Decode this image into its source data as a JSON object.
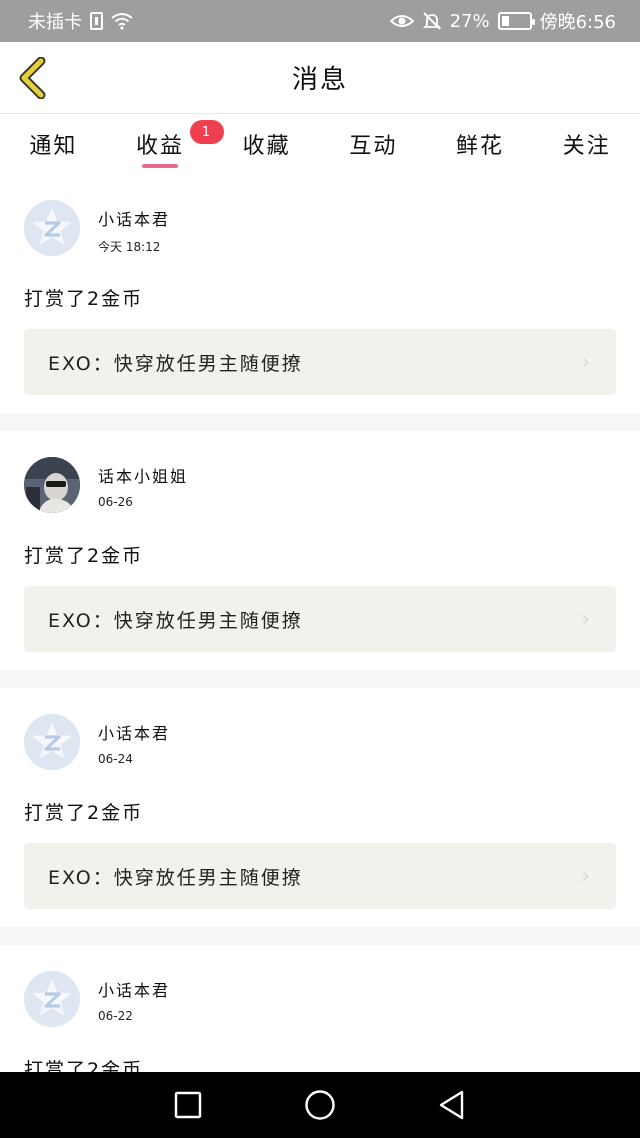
{
  "status_bar": {
    "carrier": "未插卡",
    "battery_percent": "27%",
    "time": "傍晚6:56",
    "battery_level": 0.27,
    "icons": [
      "sim-icon",
      "wifi-icon",
      "eye-icon",
      "mute-icon",
      "battery-icon"
    ]
  },
  "header": {
    "title": "消息",
    "back_icon": "chevron-left-icon",
    "accent_color": "#e6cf3a"
  },
  "tabs": [
    {
      "label": "通知",
      "active": false
    },
    {
      "label": "收益",
      "active": true,
      "badge": "1"
    },
    {
      "label": "收藏",
      "active": false
    },
    {
      "label": "互动",
      "active": false
    },
    {
      "label": "鲜花",
      "active": false
    },
    {
      "label": "关注",
      "active": false
    }
  ],
  "feed": [
    {
      "user": "小话本君",
      "date": "今天 18:12",
      "message": "打赏了2金币",
      "link": "EXO：快穿放任男主随便撩",
      "avatar": "default"
    },
    {
      "user": "话本小姐姐",
      "date": "06-26",
      "message": "打赏了2金币",
      "link": "EXO：快穿放任男主随便撩",
      "avatar": "photo"
    },
    {
      "user": "小话本君",
      "date": "06-24",
      "message": "打赏了2金币",
      "link": "EXO：快穿放任男主随便撩",
      "avatar": "default"
    },
    {
      "user": "小话本君",
      "date": "06-22",
      "message": "打赏了2金币",
      "link": "",
      "avatar": "default"
    }
  ],
  "nav": {
    "icons": [
      "square-icon",
      "circle-icon",
      "triangle-back-icon"
    ]
  },
  "colors": {
    "tab_underline": "#e46c8e",
    "badge": "#f0404f",
    "link_box": "#f2f2ec"
  }
}
